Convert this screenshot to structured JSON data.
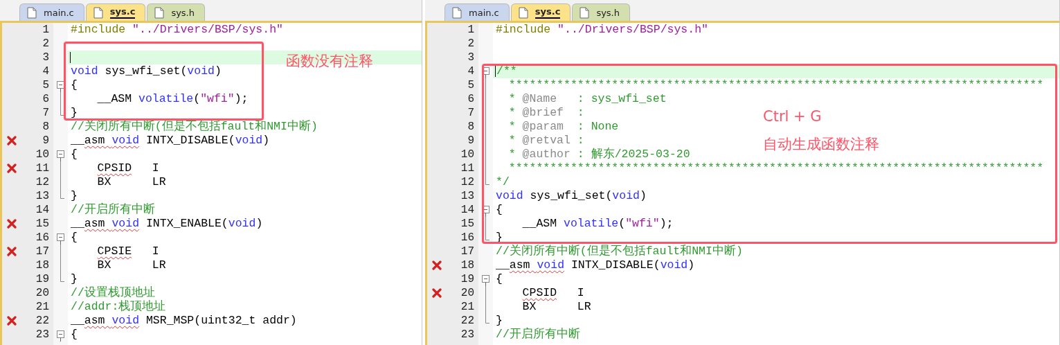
{
  "panes": [
    {
      "tabs": [
        {
          "label": "main.c",
          "selected": false,
          "color": "#c9d6ee"
        },
        {
          "label": "sys.c",
          "selected": true,
          "color": "#fce38a"
        },
        {
          "label": "sys.h",
          "selected": false,
          "color": "#d3dfae"
        }
      ],
      "callout": {
        "labels": [
          "函数没有注释"
        ]
      },
      "lines": [
        {
          "number": "1",
          "error": false,
          "current": false,
          "tokens": [
            {
              "kind": "preprocessor",
              "text": "#include"
            },
            {
              "kind": "string",
              "text": " \"../Drivers/BSP/sys.h\""
            }
          ]
        },
        {
          "number": "2",
          "error": false,
          "current": false
        },
        {
          "number": "3",
          "error": false,
          "current": true
        },
        {
          "number": "4",
          "error": false,
          "current": false,
          "tokens": [
            {
              "kind": "keyword",
              "text": "void"
            },
            {
              "kind": "plain",
              "text": " sys_wfi_set("
            },
            {
              "kind": "keyword",
              "text": "void"
            },
            {
              "kind": "plain",
              "text": ")"
            }
          ]
        },
        {
          "number": "5",
          "error": false,
          "current": false,
          "fold": {
            "kind": "open"
          },
          "tokens": [
            {
              "kind": "plain",
              "text": "{"
            }
          ]
        },
        {
          "number": "6",
          "error": false,
          "current": false,
          "fold": {
            "kind": "line"
          },
          "indent": {
            "kind": "block"
          },
          "tokens": [
            {
              "kind": "plain",
              "text": "__ASM "
            },
            {
              "kind": "keyword",
              "text": "volatile"
            },
            {
              "kind": "plain",
              "text": "("
            },
            {
              "kind": "string",
              "text": "\"wfi\""
            },
            {
              "kind": "plain",
              "text": ");"
            }
          ]
        },
        {
          "number": "7",
          "error": false,
          "current": false,
          "fold": {
            "kind": "end"
          },
          "tokens": [
            {
              "kind": "plain",
              "text": "}"
            }
          ]
        },
        {
          "number": "8",
          "error": false,
          "current": false,
          "tokens": [
            {
              "kind": "comment",
              "text": "//关闭所有中断(但是不包括fault和NMI中断)"
            }
          ]
        },
        {
          "number": "9",
          "error": true,
          "current": false,
          "tokens": [
            {
              "kind": "plain",
              "text": "__"
            },
            {
              "kind": "squiggle",
              "text": "asm "
            },
            {
              "kind": "squiggle-keyword",
              "text": "void"
            },
            {
              "kind": "plain",
              "text": " INTX_DISABLE("
            },
            {
              "kind": "keyword",
              "text": "void"
            },
            {
              "kind": "plain",
              "text": ")"
            }
          ]
        },
        {
          "number": "10",
          "error": false,
          "current": false,
          "fold": {
            "kind": "open"
          },
          "tokens": [
            {
              "kind": "plain",
              "text": "{"
            }
          ]
        },
        {
          "number": "11",
          "error": true,
          "current": false,
          "fold": {
            "kind": "line"
          },
          "indent": {
            "kind": "block"
          },
          "tokens": [
            {
              "kind": "squiggle",
              "text": "CPSID"
            },
            {
              "kind": "plain",
              "text": "   I"
            }
          ]
        },
        {
          "number": "12",
          "error": false,
          "current": false,
          "fold": {
            "kind": "line"
          },
          "indent": {
            "kind": "block"
          },
          "tokens": [
            {
              "kind": "plain",
              "text": "BX      LR"
            }
          ]
        },
        {
          "number": "13",
          "error": false,
          "current": false,
          "fold": {
            "kind": "end"
          },
          "tokens": [
            {
              "kind": "plain",
              "text": "}"
            }
          ]
        },
        {
          "number": "14",
          "error": false,
          "current": false,
          "tokens": [
            {
              "kind": "comment",
              "text": "//开启所有中断"
            }
          ]
        },
        {
          "number": "15",
          "error": true,
          "current": false,
          "tokens": [
            {
              "kind": "plain",
              "text": "__"
            },
            {
              "kind": "squiggle",
              "text": "asm "
            },
            {
              "kind": "squiggle-keyword",
              "text": "void"
            },
            {
              "kind": "plain",
              "text": " INTX_ENABLE("
            },
            {
              "kind": "keyword",
              "text": "void"
            },
            {
              "kind": "plain",
              "text": ")"
            }
          ]
        },
        {
          "number": "16",
          "error": false,
          "current": false,
          "fold": {
            "kind": "open"
          },
          "tokens": [
            {
              "kind": "plain",
              "text": "{"
            }
          ]
        },
        {
          "number": "17",
          "error": true,
          "current": false,
          "fold": {
            "kind": "line"
          },
          "indent": {
            "kind": "block"
          },
          "tokens": [
            {
              "kind": "squiggle",
              "text": "CPSIE"
            },
            {
              "kind": "plain",
              "text": "   I"
            }
          ]
        },
        {
          "number": "18",
          "error": false,
          "current": false,
          "fold": {
            "kind": "line"
          },
          "indent": {
            "kind": "block"
          },
          "tokens": [
            {
              "kind": "plain",
              "text": "BX      LR"
            }
          ]
        },
        {
          "number": "19",
          "error": false,
          "current": false,
          "fold": {
            "kind": "end"
          },
          "tokens": [
            {
              "kind": "plain",
              "text": "}"
            }
          ]
        },
        {
          "number": "20",
          "error": false,
          "current": false,
          "tokens": [
            {
              "kind": "comment",
              "text": "//设置栈顶地址"
            }
          ]
        },
        {
          "number": "21",
          "error": false,
          "current": false,
          "tokens": [
            {
              "kind": "comment",
              "text": "//addr:栈顶地址"
            }
          ]
        },
        {
          "number": "22",
          "error": true,
          "current": false,
          "tokens": [
            {
              "kind": "plain",
              "text": "__"
            },
            {
              "kind": "squiggle",
              "text": "asm "
            },
            {
              "kind": "squiggle-keyword",
              "text": "void"
            },
            {
              "kind": "plain",
              "text": " MSR_MSP(uint32_t addr)"
            }
          ]
        },
        {
          "number": "23",
          "error": false,
          "current": false,
          "fold": {
            "kind": "open"
          },
          "tokens": [
            {
              "kind": "plain",
              "text": "{"
            }
          ]
        }
      ]
    },
    {
      "tabs": [
        {
          "label": "main.c",
          "selected": false,
          "color": "#c9d6ee"
        },
        {
          "label": "sys.c",
          "selected": true,
          "color": "#fce38a"
        },
        {
          "label": "sys.h",
          "selected": false,
          "color": "#d3dfae"
        }
      ],
      "callout": {
        "labels": [
          "Ctrl + G",
          "自动生成函数注释"
        ]
      },
      "lines": [
        {
          "number": "1",
          "error": false,
          "current": false,
          "tokens": [
            {
              "kind": "preprocessor",
              "text": "#include"
            },
            {
              "kind": "string",
              "text": " \"../Drivers/BSP/sys.h\""
            }
          ]
        },
        {
          "number": "2",
          "error": false,
          "current": false
        },
        {
          "number": "3",
          "error": false,
          "current": false
        },
        {
          "number": "4",
          "error": false,
          "current": true,
          "fold": {
            "kind": "open"
          },
          "tokens": [
            {
              "kind": "comment",
              "text": "/**"
            }
          ]
        },
        {
          "number": "5",
          "error": false,
          "current": false,
          "fold": {
            "kind": "line"
          },
          "indent": {
            "kind": "doc"
          },
          "tokens": [
            {
              "kind": "comment",
              "text": "******************************************************************************"
            }
          ]
        },
        {
          "number": "6",
          "error": false,
          "current": false,
          "fold": {
            "kind": "line"
          },
          "indent": {
            "kind": "doc"
          },
          "tokens": [
            {
              "kind": "comment",
              "text": "* "
            },
            {
              "kind": "doc-tag",
              "text": "@Name"
            },
            {
              "kind": "comment",
              "text": "   : sys_wfi_set"
            }
          ]
        },
        {
          "number": "7",
          "error": false,
          "current": false,
          "fold": {
            "kind": "line"
          },
          "indent": {
            "kind": "doc"
          },
          "tokens": [
            {
              "kind": "comment",
              "text": "* "
            },
            {
              "kind": "doc-tag",
              "text": "@brief"
            },
            {
              "kind": "comment",
              "text": "  :"
            }
          ]
        },
        {
          "number": "8",
          "error": false,
          "current": false,
          "fold": {
            "kind": "line"
          },
          "indent": {
            "kind": "doc"
          },
          "tokens": [
            {
              "kind": "comment",
              "text": "* "
            },
            {
              "kind": "doc-tag",
              "text": "@param"
            },
            {
              "kind": "comment",
              "text": "  : None"
            }
          ]
        },
        {
          "number": "9",
          "error": false,
          "current": false,
          "fold": {
            "kind": "line"
          },
          "indent": {
            "kind": "doc"
          },
          "tokens": [
            {
              "kind": "comment",
              "text": "* "
            },
            {
              "kind": "doc-tag",
              "text": "@retval"
            },
            {
              "kind": "comment",
              "text": " :"
            }
          ]
        },
        {
          "number": "10",
          "error": false,
          "current": false,
          "fold": {
            "kind": "line"
          },
          "indent": {
            "kind": "doc"
          },
          "tokens": [
            {
              "kind": "comment",
              "text": "* "
            },
            {
              "kind": "doc-tag",
              "text": "@author"
            },
            {
              "kind": "comment",
              "text": " : 解东/2025-03-20"
            }
          ]
        },
        {
          "number": "11",
          "error": false,
          "current": false,
          "fold": {
            "kind": "line"
          },
          "indent": {
            "kind": "doc"
          },
          "tokens": [
            {
              "kind": "comment",
              "text": "******************************************************************************"
            }
          ]
        },
        {
          "number": "12",
          "error": false,
          "current": false,
          "fold": {
            "kind": "end"
          },
          "tokens": [
            {
              "kind": "comment",
              "text": "*/"
            }
          ]
        },
        {
          "number": "13",
          "error": false,
          "current": false,
          "tokens": [
            {
              "kind": "keyword",
              "text": "void"
            },
            {
              "kind": "plain",
              "text": " sys_wfi_set("
            },
            {
              "kind": "keyword",
              "text": "void"
            },
            {
              "kind": "plain",
              "text": ")"
            }
          ]
        },
        {
          "number": "14",
          "error": false,
          "current": false,
          "fold": {
            "kind": "open"
          },
          "tokens": [
            {
              "kind": "plain",
              "text": "{"
            }
          ]
        },
        {
          "number": "15",
          "error": false,
          "current": false,
          "fold": {
            "kind": "line"
          },
          "indent": {
            "kind": "block"
          },
          "tokens": [
            {
              "kind": "plain",
              "text": "__ASM "
            },
            {
              "kind": "keyword",
              "text": "volatile"
            },
            {
              "kind": "plain",
              "text": "("
            },
            {
              "kind": "string",
              "text": "\"wfi\""
            },
            {
              "kind": "plain",
              "text": ");"
            }
          ]
        },
        {
          "number": "16",
          "error": false,
          "current": false,
          "fold": {
            "kind": "end"
          },
          "tokens": [
            {
              "kind": "plain",
              "text": "}"
            }
          ]
        },
        {
          "number": "17",
          "error": false,
          "current": false,
          "tokens": [
            {
              "kind": "comment",
              "text": "//关闭所有中断(但是不包括fault和NMI中断)"
            }
          ]
        },
        {
          "number": "18",
          "error": true,
          "current": false,
          "tokens": [
            {
              "kind": "plain",
              "text": "__"
            },
            {
              "kind": "squiggle",
              "text": "asm "
            },
            {
              "kind": "squiggle-keyword",
              "text": "void"
            },
            {
              "kind": "plain",
              "text": " INTX_DISABLE("
            },
            {
              "kind": "keyword",
              "text": "void"
            },
            {
              "kind": "plain",
              "text": ")"
            }
          ]
        },
        {
          "number": "19",
          "error": false,
          "current": false,
          "fold": {
            "kind": "open"
          },
          "tokens": [
            {
              "kind": "plain",
              "text": "{"
            }
          ]
        },
        {
          "number": "20",
          "error": true,
          "current": false,
          "fold": {
            "kind": "line"
          },
          "indent": {
            "kind": "block"
          },
          "tokens": [
            {
              "kind": "squiggle",
              "text": "CPSID"
            },
            {
              "kind": "plain",
              "text": "   I"
            }
          ]
        },
        {
          "number": "21",
          "error": false,
          "current": false,
          "fold": {
            "kind": "line"
          },
          "indent": {
            "kind": "block"
          },
          "tokens": [
            {
              "kind": "plain",
              "text": "BX      LR"
            }
          ]
        },
        {
          "number": "22",
          "error": false,
          "current": false,
          "fold": {
            "kind": "end"
          },
          "tokens": [
            {
              "kind": "plain",
              "text": "}"
            }
          ]
        },
        {
          "number": "23",
          "error": false,
          "current": false,
          "tokens": [
            {
              "kind": "comment",
              "text": "//开启所有中断"
            }
          ]
        }
      ]
    }
  ]
}
